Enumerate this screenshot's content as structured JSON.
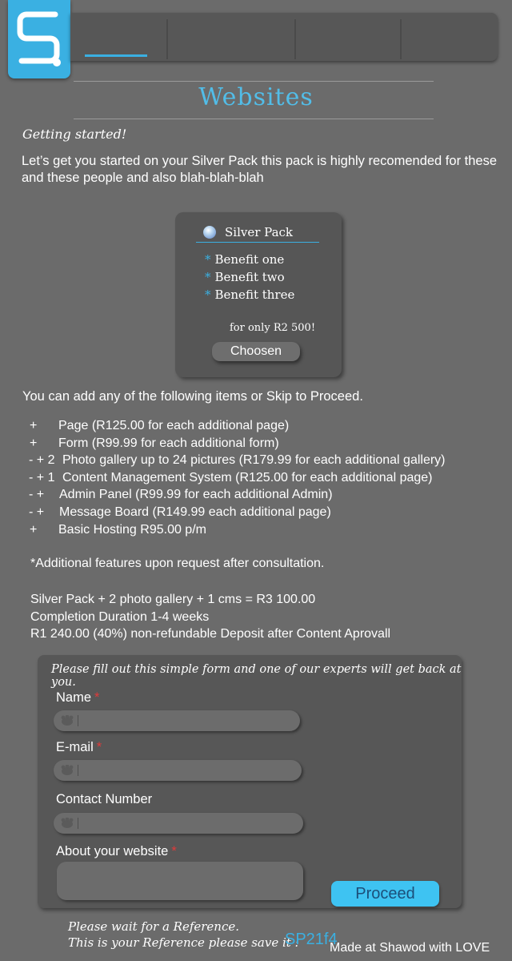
{
  "brand": {
    "logo_icon": "s-logo-icon",
    "accent": "#3ab0e2"
  },
  "nav": {
    "tabs": [
      "",
      "",
      "",
      ""
    ],
    "active_index": 0
  },
  "page": {
    "title": "Websites",
    "subtitle": "Getting started!",
    "intro": "Let’s get you started on your Silver Pack this pack is highly recomended for these and these people and also blah-blah-blah"
  },
  "pack": {
    "name": "Silver Pack",
    "benefits": [
      "Benefit one",
      "Benefit two",
      "Benefit three"
    ],
    "price": "for only R2 500!",
    "button": "Choosen",
    "benefit_marker": "*"
  },
  "addons": {
    "intro": "You can add any of the following items or Skip to Proceed.",
    "items": [
      {
        "marker": "+",
        "text": "Page (R125.00 for each additional page)"
      },
      {
        "marker": "+",
        "text": "Form (R99.99  for each additional form)"
      },
      {
        "marker": "- + 2",
        "text": "Photo gallery up to 24 pictures (R179.99  for each additional gallery)"
      },
      {
        "marker": "- + 1",
        "text": "Content Management System (R125.00 for each additional page)"
      },
      {
        "marker": "- +",
        "text": "Admin Panel (R99.99  for each additional Admin)"
      },
      {
        "marker": "- +",
        "text": "Message Board (R149.99 each additional page)"
      },
      {
        "marker": "+",
        "text": "Basic Hosting R95.00 p/m"
      }
    ],
    "additional_note": "*Additional features upon request after consultation."
  },
  "summary": [
    "Silver Pack + 2 photo gallery + 1 cms = R3 100.00",
    "Completion Duration 1-4 weeks",
    "R1 240.00 (40%) non-refundable Deposit after Content Aprovall"
  ],
  "form": {
    "intro": "Please fill out this simple form and one of our experts will get back at you.",
    "name_label": "Name",
    "email_label": "E-mail",
    "contact_label": "Contact Number",
    "about_label": "About your website",
    "required_mark": "*",
    "proceed": "Proceed"
  },
  "reference": {
    "wait": "Please wait for a Reference.",
    "save": "This is your Reference please save it :",
    "code": "SP21f4"
  },
  "footer": "Made at Shawod with LOVE"
}
